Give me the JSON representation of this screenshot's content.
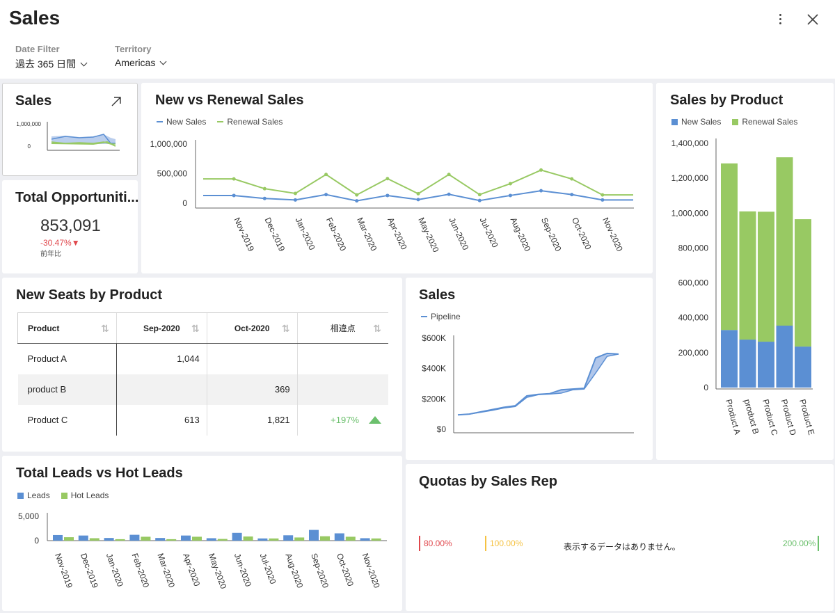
{
  "app": {
    "title": "Sales"
  },
  "filters": [
    {
      "label": "Date Filter",
      "value": "過去 365 日間"
    },
    {
      "label": "Territory",
      "value": "Americas"
    }
  ],
  "colors": {
    "blue": "#5b8fd3",
    "green": "#98c963",
    "line_blue": "#5b8fd3",
    "line_green": "#98c963",
    "red": "#e0474c",
    "yellow": "#f5c242",
    "good": "#6cc06d"
  },
  "sales_spark": {
    "title": "Sales",
    "expand_icon": "arrow-up-right-icon",
    "y_ticks": [
      "1,000,000",
      "0"
    ]
  },
  "total_opportunities": {
    "title": "Total Opportuniti...",
    "value": "853,091",
    "delta": "-30.47%▼",
    "note": "前年比"
  },
  "new_vs_renewal": {
    "title": "New vs Renewal Sales",
    "legend": [
      "New Sales",
      "Renewal Sales"
    ]
  },
  "sales_by_product": {
    "title": "Sales by Product",
    "legend": [
      "New Sales",
      "Renewal Sales"
    ]
  },
  "new_seats": {
    "title": "New Seats by Product",
    "columns": [
      "Product",
      "Sep-2020",
      "Oct-2020",
      "相違点"
    ],
    "rows": [
      [
        "Product A",
        "1,044",
        "",
        ""
      ],
      [
        "product B",
        "",
        "369",
        ""
      ],
      [
        "Product C",
        "613",
        "1,821",
        "+197%"
      ]
    ]
  },
  "pipeline": {
    "title": "Sales",
    "legend": [
      "Pipeline"
    ]
  },
  "leads": {
    "title": "Total Leads vs Hot Leads",
    "legend": [
      "Leads",
      "Hot Leads"
    ]
  },
  "quotas": {
    "title": "Quotas by Sales Rep",
    "empty": "表示するデータはありません。",
    "marks": [
      "80.00%",
      "100.00%",
      "200.00%"
    ]
  },
  "chart_data": [
    {
      "type": "line",
      "title": "New vs Renewal Sales",
      "categories": [
        "Nov-2019",
        "Nov-2019",
        "Dec-2019",
        "Jan-2020",
        "Feb-2020",
        "Mar-2020",
        "Apr-2020",
        "May-2020",
        "Jun-2020",
        "Jul-2020",
        "Aug-2020",
        "Sep-2020",
        "Oct-2020",
        "Nov-2020",
        "Nov-2020"
      ],
      "x_tick_labels": [
        "Nov-2019",
        "Dec-2019",
        "Jan-2020",
        "Feb-2020",
        "Mar-2020",
        "Apr-2020",
        "May-2020",
        "Jun-2020",
        "Jul-2020",
        "Aug-2020",
        "Sep-2020",
        "Oct-2020",
        "Nov-2020"
      ],
      "y_ticks": [
        "1,000,000",
        "500,000",
        "0"
      ],
      "ylim": [
        0,
        1000000
      ],
      "series": [
        {
          "name": "New Sales",
          "values": [
            130000,
            130000,
            80000,
            55000,
            145000,
            40000,
            130000,
            60000,
            150000,
            45000,
            130000,
            210000,
            145000,
            55000,
            55000
          ]
        },
        {
          "name": "Renewal Sales",
          "values": [
            410000,
            410000,
            245000,
            165000,
            485000,
            140000,
            415000,
            160000,
            485000,
            145000,
            330000,
            560000,
            410000,
            140000,
            140000
          ]
        }
      ]
    },
    {
      "type": "bar",
      "title": "Sales by Product",
      "stacked": true,
      "categories": [
        "Product A",
        "product B",
        "Product C",
        "Product D",
        "Product E"
      ],
      "y_ticks": [
        "1,400,000",
        "1,200,000",
        "1,000,000",
        "800,000",
        "600,000",
        "400,000",
        "200,000",
        "0"
      ],
      "ylim": [
        0,
        1400000
      ],
      "series": [
        {
          "name": "New Sales",
          "values": [
            330000,
            275000,
            263000,
            355000,
            235000
          ]
        },
        {
          "name": "Renewal Sales",
          "values": [
            955000,
            735000,
            745000,
            965000,
            730000
          ]
        }
      ]
    },
    {
      "type": "area",
      "title": "Sales",
      "x_count": 15,
      "y_ticks": [
        "$600K",
        "$400K",
        "$200K",
        "$0"
      ],
      "ylim": [
        0,
        600000
      ],
      "series": [
        {
          "name": "Pipeline",
          "values": [
            95000,
            100000,
            115000,
            130000,
            145000,
            155000,
            220000,
            230000,
            235000,
            260000,
            265000,
            270000,
            470000,
            500000,
            495000
          ]
        },
        {
          "name": "Pipeline (lower)",
          "values": [
            95000,
            100000,
            112000,
            125000,
            140000,
            150000,
            210000,
            228000,
            232000,
            238000,
            260000,
            265000,
            370000,
            480000,
            495000
          ]
        }
      ]
    },
    {
      "type": "bar",
      "title": "Total Leads vs Hot Leads",
      "categories": [
        "Nov-2019",
        "Dec-2019",
        "Jan-2020",
        "Feb-2020",
        "Mar-2020",
        "Apr-2020",
        "May-2020",
        "Jun-2020",
        "Jul-2020",
        "Aug-2020",
        "Sep-2020",
        "Oct-2020",
        "Nov-2020"
      ],
      "y_ticks": [
        "5,000",
        "0"
      ],
      "ylim": [
        0,
        5000
      ],
      "series": [
        {
          "name": "Leads",
          "values": [
            1150,
            1050,
            550,
            1200,
            550,
            1050,
            500,
            1600,
            450,
            1100,
            2200,
            1500,
            500
          ]
        },
        {
          "name": "Hot Leads",
          "values": [
            700,
            500,
            300,
            800,
            300,
            800,
            350,
            850,
            450,
            650,
            900,
            800,
            450
          ]
        }
      ]
    }
  ]
}
